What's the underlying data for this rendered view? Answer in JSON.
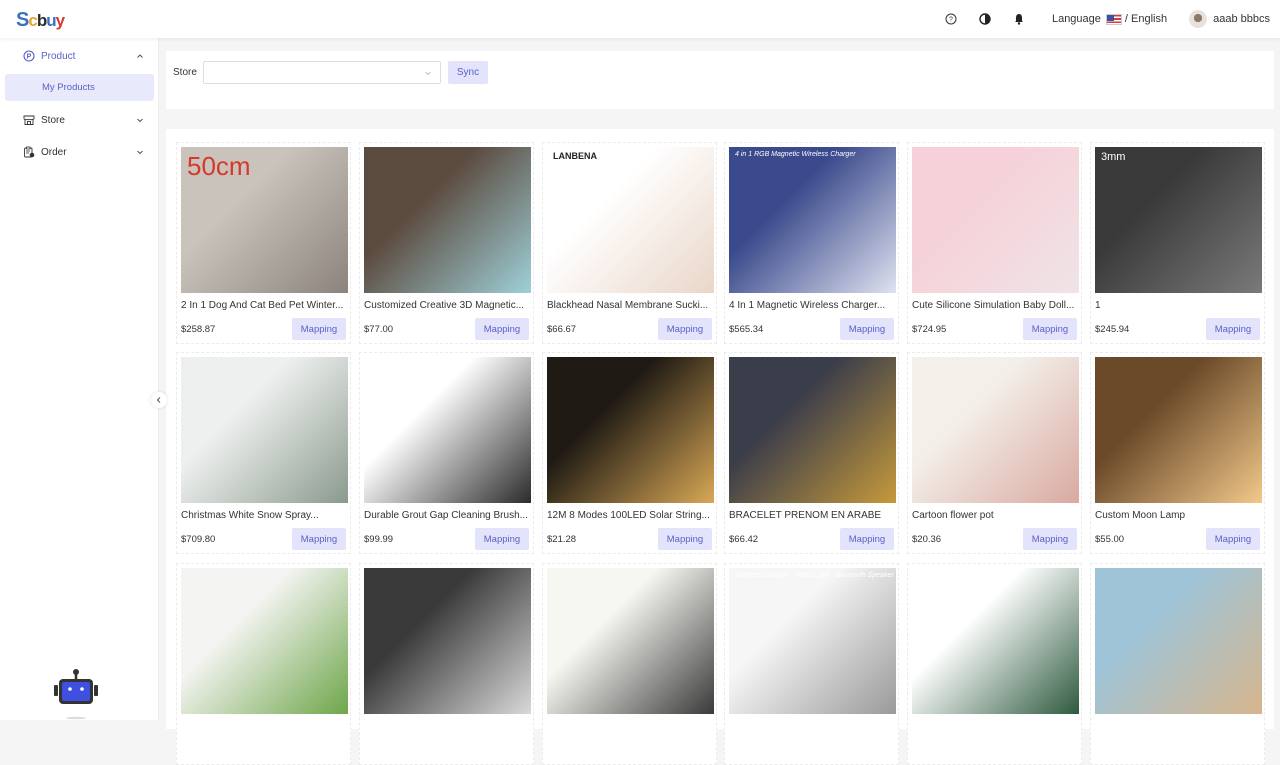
{
  "header": {
    "logo": {
      "s": "S",
      "c1": "c",
      "c2": "b",
      "c3": "u",
      "c4": "y"
    },
    "icons": [
      "help-icon",
      "theme-toggle-icon",
      "bell-icon"
    ],
    "language_label": "Language",
    "language_value": "/ English",
    "user_name": "aaab bbbcs"
  },
  "sidebar": {
    "items": [
      {
        "label": "Product",
        "icon": "product-icon",
        "expanded": true,
        "children": [
          {
            "label": "My Products",
            "active": true
          }
        ]
      },
      {
        "label": "Store",
        "icon": "store-icon",
        "expanded": false
      },
      {
        "label": "Order",
        "icon": "order-icon",
        "expanded": false
      }
    ]
  },
  "filter": {
    "store_label": "Store",
    "store_value": "",
    "sync_label": "Sync"
  },
  "products": [
    {
      "title": "2 In 1 Dog And Cat Bed Pet Winter...",
      "price": "$258.87",
      "action": "Mapping",
      "img_label": "50cm",
      "img_colors": [
        "#c9c3bb",
        "#8c847c"
      ]
    },
    {
      "title": "Customized Creative 3D Magnetic...",
      "price": "$77.00",
      "action": "Mapping",
      "img_label": "",
      "img_colors": [
        "#5b4a3e",
        "#9fd0d8"
      ]
    },
    {
      "title": "Blackhead Nasal Membrane Sucki...",
      "price": "$66.67",
      "action": "Mapping",
      "img_label": "LANBENA",
      "img_colors": [
        "#ffffff",
        "#e9d6c8"
      ]
    },
    {
      "title": "4 In 1 Magnetic Wireless Charger...",
      "price": "$565.34",
      "action": "Mapping",
      "img_label": "4 in 1 RGB Magnetic Wireless Charger",
      "img_colors": [
        "#3a4a8c",
        "#dfe2f0"
      ]
    },
    {
      "title": "Cute Silicone Simulation Baby Doll...",
      "price": "$724.95",
      "action": "Mapping",
      "img_label": "",
      "img_colors": [
        "#f6d1d9",
        "#efe4e6"
      ]
    },
    {
      "title": "1",
      "price": "$245.94",
      "action": "Mapping",
      "img_label": "3mm",
      "img_colors": [
        "#3a3a3a",
        "#7a7a7a"
      ]
    },
    {
      "title": "Christmas White Snow Spray...",
      "price": "$709.80",
      "action": "Mapping",
      "img_label": "",
      "img_colors": [
        "#eef0ef",
        "#8b9a8d"
      ]
    },
    {
      "title": "Durable Grout Gap Cleaning Brush...",
      "price": "$99.99",
      "action": "Mapping",
      "img_label": "",
      "img_colors": [
        "#ffffff",
        "#2b2b2b"
      ]
    },
    {
      "title": "12M 8 Modes 100LED Solar String...",
      "price": "$21.28",
      "action": "Mapping",
      "img_label": "",
      "img_colors": [
        "#1f1a14",
        "#d9a856"
      ]
    },
    {
      "title": "BRACELET PRENOM EN ARABE",
      "price": "$66.42",
      "action": "Mapping",
      "img_label": "",
      "img_colors": [
        "#3a3d4a",
        "#c59a3b"
      ]
    },
    {
      "title": "Cartoon flower pot",
      "price": "$20.36",
      "action": "Mapping",
      "img_label": "",
      "img_colors": [
        "#f3efe9",
        "#d9a9a0"
      ]
    },
    {
      "title": "Custom Moon Lamp",
      "price": "$55.00",
      "action": "Mapping",
      "img_label": "",
      "img_colors": [
        "#6b4a2a",
        "#f2c98a"
      ]
    },
    {
      "title": "",
      "price": "",
      "action": "",
      "img_label": "",
      "img_colors": [
        "#f4f4f2",
        "#6ea64a"
      ]
    },
    {
      "title": "",
      "price": "",
      "action": "",
      "img_label": "",
      "img_colors": [
        "#3a3a3a",
        "#d9d9d9"
      ]
    },
    {
      "title": "",
      "price": "",
      "action": "",
      "img_label": "",
      "img_colors": [
        "#f7f7f2",
        "#3a3a3a"
      ]
    },
    {
      "title": "",
      "price": "",
      "action": "",
      "img_label": "Wireless Charger · Mood Light · Bluetooth Speaker",
      "img_colors": [
        "#f6f6f6",
        "#9a9a9a"
      ]
    },
    {
      "title": "",
      "price": "",
      "action": "",
      "img_label": "",
      "img_colors": [
        "#ffffff",
        "#2e5a3f"
      ]
    },
    {
      "title": "",
      "price": "",
      "action": "",
      "img_label": "",
      "img_colors": [
        "#9fc3d6",
        "#d6b58c"
      ]
    }
  ],
  "colors": {
    "accent": "#5a5fc7",
    "accent_bg": "#e3e4fb",
    "active_bg": "#e8e9fb"
  }
}
